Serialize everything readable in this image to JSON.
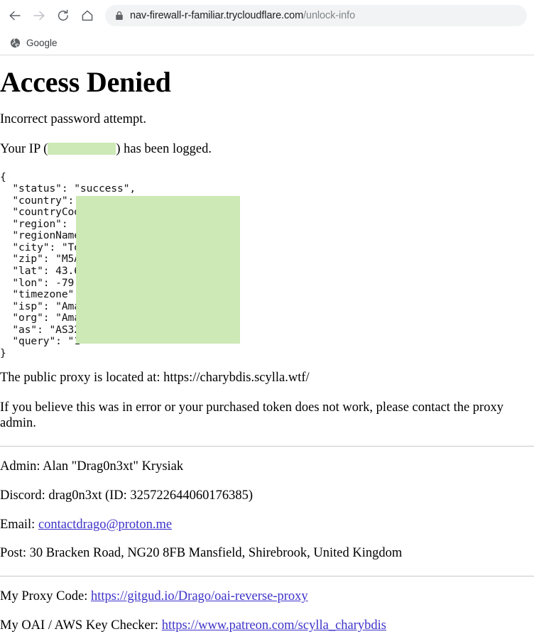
{
  "browser": {
    "nav": {
      "back_label": "Back",
      "forward_label": "Forward",
      "reload_label": "Reload",
      "home_label": "Home"
    },
    "omnibox": {
      "lock_icon": "lock-icon",
      "url_domain": "nav-firewall-r-familiar.trycloudflare.com",
      "url_path": "/unlock-info"
    },
    "bookmarks": [
      {
        "icon": "globe-icon",
        "label": "Google"
      }
    ]
  },
  "page": {
    "title": "Access Denied",
    "incorrect_password": "Incorrect password attempt.",
    "ip_prefix": "Your IP (",
    "ip_suffix": ") has been logged.",
    "json": {
      "open_brace": "{",
      "close_brace": "}",
      "lines": [
        "  \"status\": \"success\",",
        "  \"country\": ",
        "  \"countryCod",
        "  \"region\": ",
        "  \"regionName",
        "  \"city\": \"To",
        "  \"zip\": \"M5A",
        "  \"lat\": 43.6",
        "  \"lon\": -79",
        "  \"timezone\"",
        "  \"isp\": \"Ama",
        "  \"org\": \"Ama",
        "  \"as\": \"AS32",
        "  \"query\": \"1"
      ]
    },
    "proxy_location": "The public proxy is located at: https://charybdis.scylla.wtf/",
    "error_notice": "If you believe this was in error or your purchased token does not work, please contact the proxy admin.",
    "contact": {
      "admin": "Admin: Alan \"Drag0n3xt\" Krysiak",
      "discord": "Discord: drag0n3xt (ID: 325722644060176385)",
      "email_label": "Email: ",
      "email_link": "contactdrago@proton.me",
      "post": "Post: 30 Bracken Road, NG20 8FB Mansfield, Shirebrook, United Kingdom"
    },
    "links": {
      "proxy_code_label": "My Proxy Code: ",
      "proxy_code_link": "https://gitgud.io/Drago/oai-reverse-proxy",
      "key_checker_label": "My OAI / AWS Key Checker: ",
      "key_checker_link": "https://www.patreon.com/scylla_charybdis"
    }
  },
  "colors": {
    "redaction_green": "#cde9b5",
    "link_purple": "#3d33c9",
    "omnibox_bg": "#f1f3f4"
  }
}
